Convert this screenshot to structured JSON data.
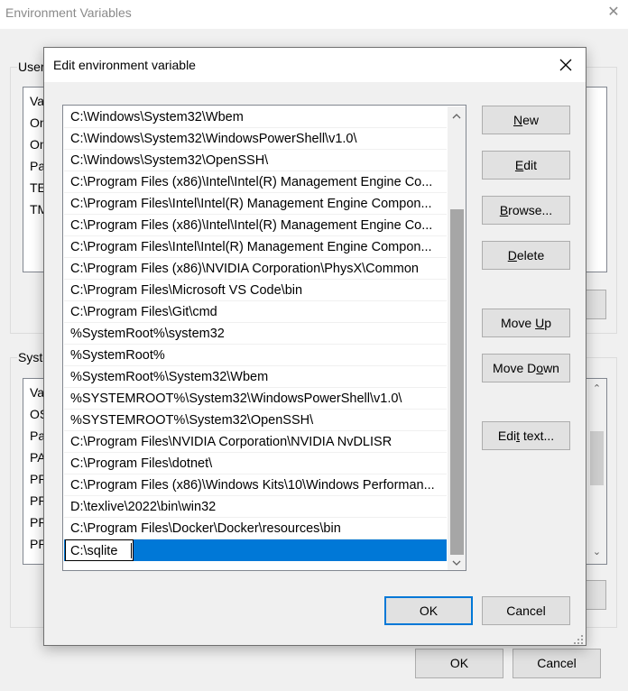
{
  "background_window": {
    "title": "Environment Variables",
    "user_group_label": "User",
    "user_rows": [
      "Va",
      "On",
      "On",
      "Pa",
      "TE",
      "TM"
    ],
    "system_group_label": "System",
    "system_rows": [
      "Va",
      "OS",
      "Pa",
      "PA",
      "PR",
      "PR",
      "PR",
      "PR"
    ],
    "ok_label": "OK",
    "cancel_label": "Cancel"
  },
  "dialog": {
    "title": "Edit environment variable",
    "paths": [
      "C:\\Windows\\System32\\Wbem",
      "C:\\Windows\\System32\\WindowsPowerShell\\v1.0\\",
      "C:\\Windows\\System32\\OpenSSH\\",
      "C:\\Program Files (x86)\\Intel\\Intel(R) Management Engine Co...",
      "C:\\Program Files\\Intel\\Intel(R) Management Engine Compon...",
      "C:\\Program Files (x86)\\Intel\\Intel(R) Management Engine Co...",
      "C:\\Program Files\\Intel\\Intel(R) Management Engine Compon...",
      "C:\\Program Files (x86)\\NVIDIA Corporation\\PhysX\\Common",
      "C:\\Program Files\\Microsoft VS Code\\bin",
      "C:\\Program Files\\Git\\cmd",
      "%SystemRoot%\\system32",
      "%SystemRoot%",
      "%SystemRoot%\\System32\\Wbem",
      "%SYSTEMROOT%\\System32\\WindowsPowerShell\\v1.0\\",
      "%SYSTEMROOT%\\System32\\OpenSSH\\",
      "C:\\Program Files\\NVIDIA Corporation\\NVIDIA NvDLISR",
      "C:\\Program Files\\dotnet\\",
      "C:\\Program Files (x86)\\Windows Kits\\10\\Windows Performan...",
      "D:\\texlive\\2022\\bin\\win32",
      "C:\\Program Files\\Docker\\Docker\\resources\\bin"
    ],
    "editing_value": "C:\\sqlite",
    "buttons": {
      "new": {
        "pre": "",
        "key": "N",
        "post": "ew"
      },
      "edit": {
        "pre": "",
        "key": "E",
        "post": "dit"
      },
      "browse": {
        "pre": "",
        "key": "B",
        "post": "rowse..."
      },
      "delete": {
        "pre": "",
        "key": "D",
        "post": "elete"
      },
      "move_up": {
        "pre": "Move ",
        "key": "U",
        "post": "p"
      },
      "move_down": {
        "pre": "Move D",
        "key": "o",
        "post": "wn"
      },
      "edit_text": {
        "pre": "Edi",
        "key": "t",
        "post": " text..."
      },
      "ok": "OK",
      "cancel": "Cancel"
    }
  },
  "icons": {
    "close": "close-icon",
    "scroll_up": "chevron-up-icon",
    "scroll_down": "chevron-down-icon",
    "resize": "resize-grip-icon"
  },
  "colors": {
    "selection": "#0078d7",
    "default_button_border": "#0078d7",
    "button_face": "#e1e1e1",
    "scroll_thumb": "#a6a6a6"
  },
  "scroll_position": {
    "first_visible_row": 8,
    "visible_rows": 21
  }
}
